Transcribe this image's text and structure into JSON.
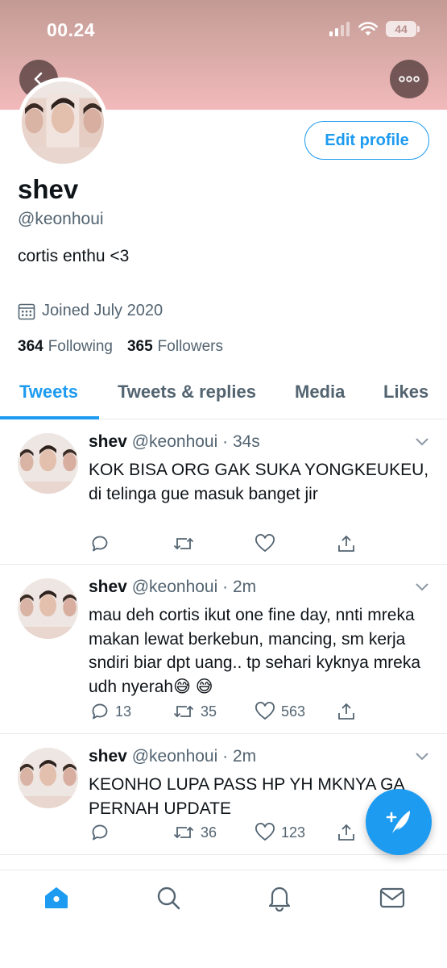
{
  "status_bar": {
    "time": "00.24",
    "battery": "44"
  },
  "header": {
    "icons": [
      "back-arrow-icon",
      "more-icon"
    ]
  },
  "profile": {
    "edit_button": "Edit profile",
    "display_name": "shev",
    "handle": "@keonhoui",
    "bio": "cortis enthu <3",
    "joined": "Joined July 2020",
    "following_count": "364",
    "following_label": "Following",
    "followers_count": "365",
    "followers_label": "Followers"
  },
  "tabs": [
    {
      "label": "Tweets",
      "active": true
    },
    {
      "label": "Tweets & replies",
      "active": false
    },
    {
      "label": "Media",
      "active": false
    },
    {
      "label": "Likes",
      "active": false
    }
  ],
  "tweets": [
    {
      "name": "shev",
      "meta": "@keonhoui · 34s",
      "text": "KOK BISA ORG GAK SUKA YONGKEUKEU, di telinga gue masuk banget jir",
      "replies": "",
      "retweets": "",
      "likes": ""
    },
    {
      "name": "shev",
      "meta": "@keonhoui · 2m",
      "text": "mau deh cortis ikut one fine day, nnti mreka makan lewat berkebun, mancing, sm kerja sndiri biar dpt uang.. tp sehari kyknya mreka udh nyerah😅 😅",
      "replies": "13",
      "retweets": "35",
      "likes": "563"
    },
    {
      "name": "shev",
      "meta": "@keonhoui · 2m",
      "text": "KEONHO LUPA PASS HP YH MKNYA GA PERNAH UPDATE",
      "replies": "",
      "retweets": "36",
      "likes": "123"
    }
  ],
  "bottom_nav": [
    "home-icon",
    "search-icon",
    "notifications-icon",
    "messages-icon"
  ],
  "colors": {
    "accent": "#1d9bf0",
    "text": "#0f1419",
    "secondary": "#536471"
  }
}
